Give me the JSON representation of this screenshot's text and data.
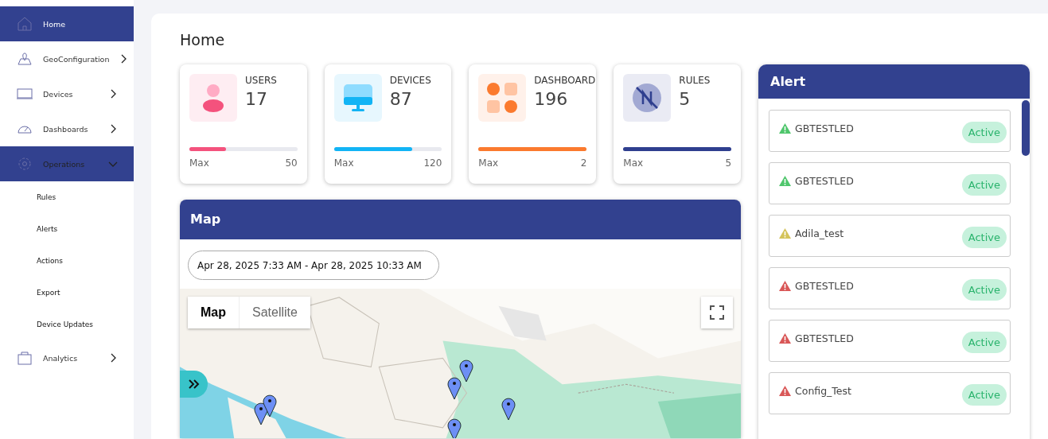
{
  "sidebar": {
    "items": [
      {
        "label": "Home",
        "kind": "home",
        "submenu": false,
        "selected": true,
        "expanded": false
      },
      {
        "label": "GeoConfiguration",
        "kind": "geo",
        "submenu": true,
        "selected": false,
        "expanded": false
      },
      {
        "label": "Devices",
        "kind": "laptop",
        "submenu": true,
        "selected": false,
        "expanded": false
      },
      {
        "label": "Dashboards",
        "kind": "gauge",
        "submenu": true,
        "selected": false,
        "expanded": false
      },
      {
        "label": "Operations",
        "kind": "gear",
        "submenu": true,
        "selected": false,
        "expanded": true,
        "children": [
          {
            "label": "Rules"
          },
          {
            "label": "Alerts"
          },
          {
            "label": "Actions"
          },
          {
            "label": "Export"
          },
          {
            "label": "Device Updates"
          }
        ]
      },
      {
        "label": "Analytics",
        "kind": "bag",
        "submenu": true,
        "selected": false,
        "expanded": false
      }
    ]
  },
  "page_title": "Home",
  "stats": [
    {
      "kind": "users",
      "label": "USERS",
      "value": "17",
      "level": 0.34,
      "max_label": "Max",
      "max": "50",
      "color": "#f4527d"
    },
    {
      "kind": "devices",
      "label": "DEVICES",
      "value": "87",
      "level": 0.725,
      "max_label": "Max",
      "max": "120",
      "color": "#12b4f5"
    },
    {
      "kind": "dashboard",
      "label": "DASHBOARD",
      "value": "196",
      "level": 1,
      "max_label": "Max",
      "max": "2",
      "color": "#fb7a2e"
    },
    {
      "kind": "rules",
      "label": "RULES",
      "value": "5",
      "level": 1,
      "max_label": "Max",
      "max": "5",
      "color": "#2f3f8f"
    }
  ],
  "map": {
    "title": "Map",
    "date_range": "Apr 28, 2025 7:33 AM - Apr 28, 2025 10:33 AM",
    "map_types": [
      {
        "label": "Map",
        "selected": true
      },
      {
        "label": "Satellite",
        "selected": false
      }
    ]
  },
  "alerts": {
    "title": "Alert",
    "items": [
      {
        "name": "GBTESTLED",
        "color": "#4fc66c",
        "status": "Active"
      },
      {
        "name": "GBTESTLED",
        "color": "#4fc66c",
        "status": "Active"
      },
      {
        "name": "Adila_test",
        "color": "#d4c35a",
        "status": "Active"
      },
      {
        "name": "GBTESTLED",
        "color": "#d95757",
        "status": "Active"
      },
      {
        "name": "GBTESTLED",
        "color": "#d95757",
        "status": "Active"
      },
      {
        "name": "Config_Test",
        "color": "#d95757",
        "status": "Active"
      }
    ]
  }
}
